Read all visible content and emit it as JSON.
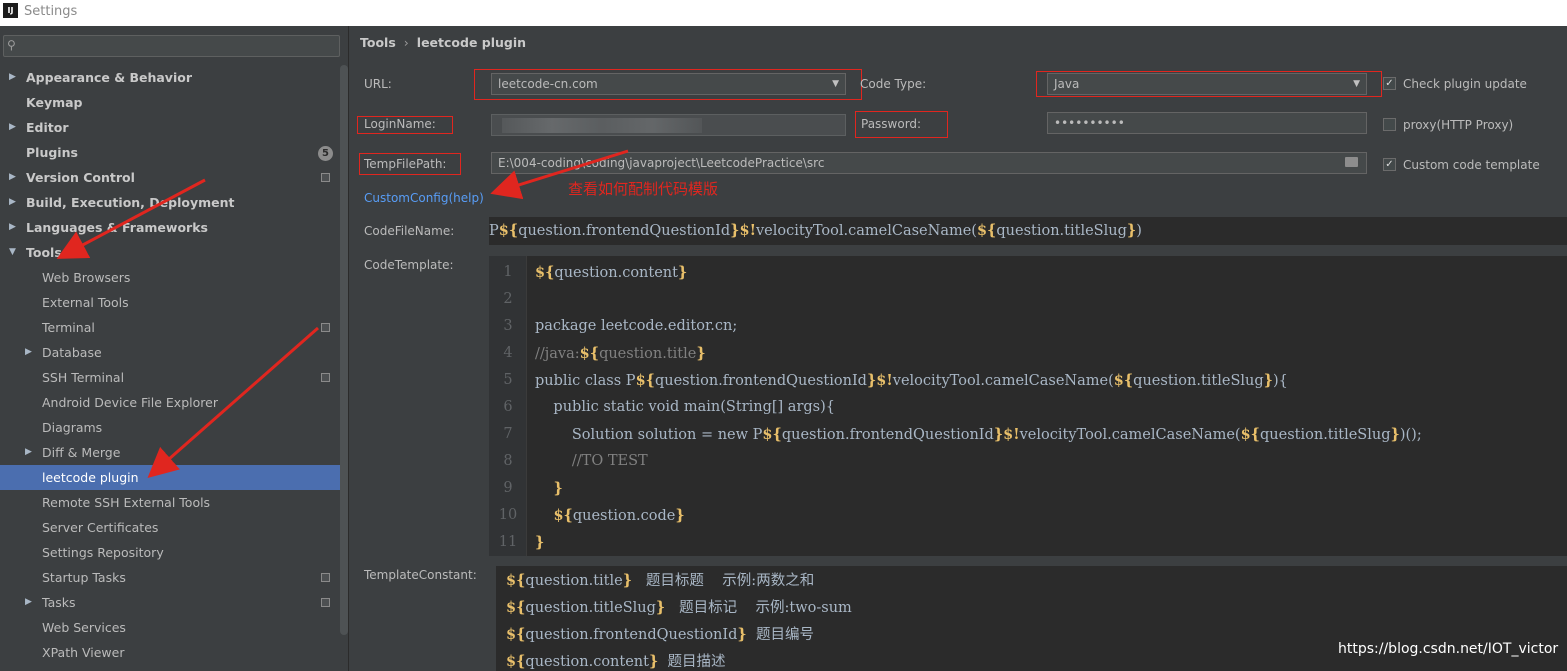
{
  "window": {
    "title": "Settings",
    "logo_text": "IJ"
  },
  "sidebar": {
    "search_value": "",
    "items": [
      {
        "label": "Appearance & Behavior",
        "bold": true,
        "level": 0,
        "arrow": "▶"
      },
      {
        "label": "Keymap",
        "bold": true,
        "level": 0,
        "arrow": ""
      },
      {
        "label": "Editor",
        "bold": true,
        "level": 0,
        "arrow": "▶"
      },
      {
        "label": "Plugins",
        "bold": true,
        "level": 0,
        "arrow": "",
        "badge": "5"
      },
      {
        "label": "Version Control",
        "bold": true,
        "level": 0,
        "arrow": "▶",
        "proj_icon": true
      },
      {
        "label": "Build, Execution, Deployment",
        "bold": true,
        "level": 0,
        "arrow": "▶"
      },
      {
        "label": "Languages & Frameworks",
        "bold": true,
        "level": 0,
        "arrow": "▶"
      },
      {
        "label": "Tools",
        "bold": true,
        "level": 0,
        "arrow": "▼"
      },
      {
        "label": "Web Browsers",
        "bold": false,
        "level": 1,
        "arrow": ""
      },
      {
        "label": "External Tools",
        "bold": false,
        "level": 1,
        "arrow": ""
      },
      {
        "label": "Terminal",
        "bold": false,
        "level": 1,
        "arrow": "",
        "proj_icon": true
      },
      {
        "label": "Database",
        "bold": false,
        "level": 1,
        "arrow": "▶"
      },
      {
        "label": "SSH Terminal",
        "bold": false,
        "level": 1,
        "arrow": "",
        "proj_icon": true
      },
      {
        "label": "Android Device File Explorer",
        "bold": false,
        "level": 1,
        "arrow": ""
      },
      {
        "label": "Diagrams",
        "bold": false,
        "level": 1,
        "arrow": ""
      },
      {
        "label": "Diff & Merge",
        "bold": false,
        "level": 1,
        "arrow": "▶"
      },
      {
        "label": "leetcode plugin",
        "bold": false,
        "level": 1,
        "arrow": "",
        "selected": true
      },
      {
        "label": "Remote SSH External Tools",
        "bold": false,
        "level": 1,
        "arrow": ""
      },
      {
        "label": "Server Certificates",
        "bold": false,
        "level": 1,
        "arrow": ""
      },
      {
        "label": "Settings Repository",
        "bold": false,
        "level": 1,
        "arrow": ""
      },
      {
        "label": "Startup Tasks",
        "bold": false,
        "level": 1,
        "arrow": "",
        "proj_icon": true
      },
      {
        "label": "Tasks",
        "bold": false,
        "level": 1,
        "arrow": "▶",
        "proj_icon": true
      },
      {
        "label": "Web Services",
        "bold": false,
        "level": 1,
        "arrow": ""
      },
      {
        "label": "XPath Viewer",
        "bold": false,
        "level": 1,
        "arrow": ""
      }
    ]
  },
  "breadcrumb": {
    "parent": "Tools",
    "separator": "›",
    "current": "leetcode plugin"
  },
  "form": {
    "url_label": "URL:",
    "url_value": "leetcode-cn.com",
    "code_type_label": "Code Type:",
    "code_type_value": "Java",
    "check_update_label": "Check plugin update",
    "check_update_checked": true,
    "login_label": "LoginName:",
    "password_label": "Password:",
    "password_value": "••••••••••",
    "proxy_label": "proxy(HTTP Proxy)",
    "proxy_checked": false,
    "temp_path_label": "TempFilePath:",
    "temp_path_value": "E:\\004-coding\\coding\\javaproject\\LeetcodePractice\\src",
    "custom_template_label": "Custom code template",
    "custom_template_checked": true,
    "custom_config_link": "CustomConfig(help)",
    "annotation_text": "查看如何配制代码模版",
    "code_filename_label": "CodeFileName:",
    "code_template_label": "CodeTemplate:",
    "template_constant_label": "TemplateConstant:"
  },
  "code_filename_value": "P${question.frontendQuestionId}$!velocityTool.camelCaseName(${question.titleSlug})",
  "code_template_lines": [
    "${question.content}",
    "",
    "package leetcode.editor.cn;",
    "//java:${question.title}",
    "public class P${question.frontendQuestionId}$!velocityTool.camelCaseName(${question.titleSlug}){",
    "    public static void main(String[] args){",
    "        Solution solution = new P${question.frontendQuestionId}$!velocityTool.camelCaseName(${question.titleSlug})();",
    "        //TO TEST",
    "    }",
    "    ${question.code}",
    "}"
  ],
  "template_constant_lines": [
    "${question.title}   题目标题    示例:两数之和",
    "${question.titleSlug}   题目标记    示例:two-sum",
    "${question.frontendQuestionId}  题目编号",
    "${question.content}  题目描述"
  ],
  "watermark": "https://blog.csdn.net/IOT_victor",
  "colors": {
    "accent": "#4b6eaf",
    "annotation": "#e0261f",
    "link": "#589df6",
    "velocity_var": "#e8bf6a"
  }
}
